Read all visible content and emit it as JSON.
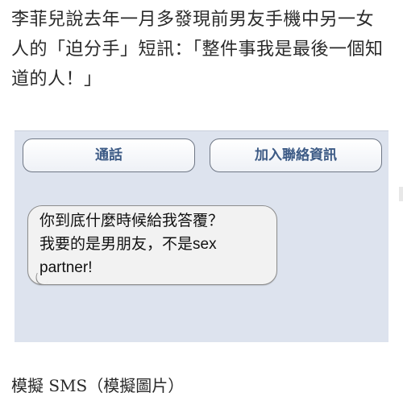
{
  "article": {
    "caption": "李菲兒說去年一月多發現前男友手機中另一女人的「迫分手」短訊：「整件事我是最後一個知道的人！」",
    "image_caption": "模擬 SMS（模擬圖片）"
  },
  "sms": {
    "buttons": {
      "call_label": "通話",
      "add_contact_label": "加入聯絡資訊"
    },
    "message": {
      "line1": "你到底什麼時候給我答覆？",
      "line2": "我要的是男朋友，不是sex",
      "line3": "partner!"
    }
  },
  "colors": {
    "frame_background": "#dde3ee",
    "bubble_background": "#f2f2f2",
    "button_text": "#3c5a85"
  }
}
